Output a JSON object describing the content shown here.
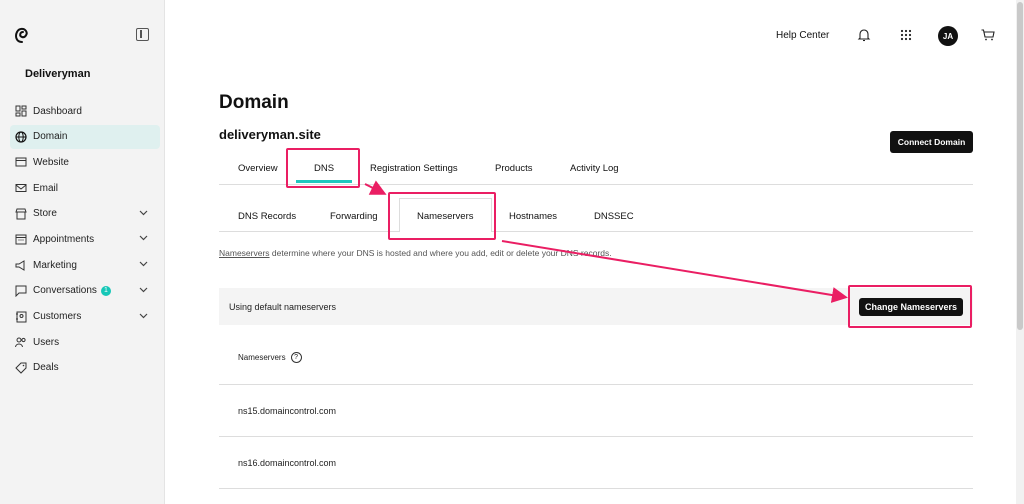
{
  "sidebar": {
    "brand": "Deliveryman",
    "items": [
      {
        "label": "Dashboard",
        "icon": "dashboard-icon",
        "chevron": false
      },
      {
        "label": "Domain",
        "icon": "globe-icon",
        "chevron": false,
        "active": true
      },
      {
        "label": "Website",
        "icon": "website-icon",
        "chevron": false
      },
      {
        "label": "Email",
        "icon": "mail-icon",
        "chevron": false
      },
      {
        "label": "Store",
        "icon": "store-icon",
        "chevron": true
      },
      {
        "label": "Appointments",
        "icon": "calendar-icon",
        "chevron": true
      },
      {
        "label": "Marketing",
        "icon": "megaphone-icon",
        "chevron": true
      },
      {
        "label": "Conversations",
        "icon": "chat-icon",
        "chevron": true,
        "badge": "1"
      },
      {
        "label": "Customers",
        "icon": "contacts-icon",
        "chevron": true
      },
      {
        "label": "Users",
        "icon": "users-icon",
        "chevron": false
      },
      {
        "label": "Deals",
        "icon": "tag-icon",
        "chevron": false
      }
    ]
  },
  "topbar": {
    "help": "Help Center",
    "avatar_initials": "JA"
  },
  "main": {
    "title": "Domain",
    "domain": "deliveryman.site",
    "connect_button": "Connect Domain",
    "tabs": [
      "Overview",
      "DNS",
      "Registration Settings",
      "Products",
      "Activity Log"
    ],
    "active_tab": "DNS",
    "subtabs": [
      "DNS Records",
      "Forwarding",
      "Nameservers",
      "Hostnames",
      "DNSSEC"
    ],
    "active_subtab": "Nameservers",
    "description_link": "Nameservers",
    "description_rest": " determine where your DNS is hosted and where you add, edit or delete your DNS records.",
    "banner_text": "Using default nameservers",
    "change_button": "Change Nameservers",
    "ns_header": "Nameservers",
    "nameservers": [
      "ns15.domaincontrol.com",
      "ns16.domaincontrol.com"
    ]
  },
  "colors": {
    "accent": "#21c7bf",
    "highlight": "#ea1e63",
    "active_nav_bg": "#dff0ef"
  }
}
